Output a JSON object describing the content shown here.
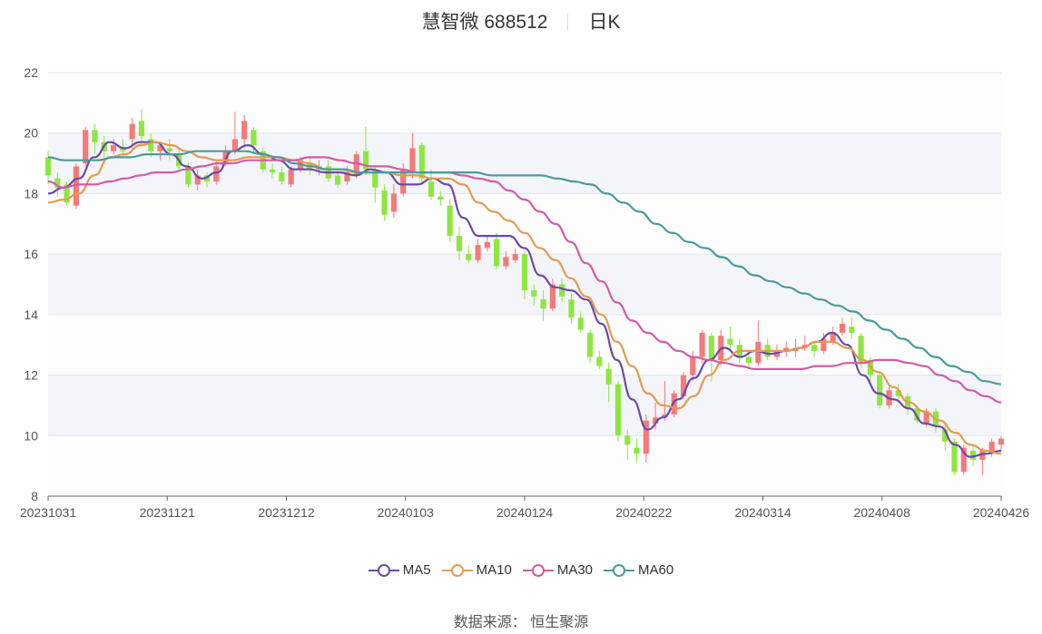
{
  "header": {
    "stock": "慧智微 688512",
    "period": "日K"
  },
  "source": {
    "label": "数据来源：",
    "name": "恒生聚源"
  },
  "colors": {
    "up": "#f47a7a",
    "down": "#8ee640",
    "MA5": "#6a4aa8",
    "MA10": "#e69a50",
    "MA30": "#d45aa7",
    "MA60": "#4b9b9b"
  },
  "chart_data": {
    "type": "candlestick",
    "ylim": [
      8,
      22
    ],
    "yticks": [
      8,
      10,
      12,
      14,
      16,
      18,
      20,
      22
    ],
    "xticks": [
      "20231031",
      "20231121",
      "20231212",
      "20240103",
      "20240124",
      "20240222",
      "20240314",
      "20240408",
      "20240426"
    ],
    "grid": true,
    "legend_position": "bottom",
    "series": [
      {
        "name": "MA5",
        "values": [
          18.0,
          18.2,
          18.5,
          19.2,
          19.7,
          19.5,
          19.7,
          19.7,
          19.3,
          18.9,
          18.5,
          18.7,
          19.4,
          19.6,
          19.3,
          19.1,
          18.8,
          18.8,
          18.7,
          18.7,
          18.6,
          18.8,
          18.7,
          18.3,
          18.3,
          18.5,
          18.3,
          17.2,
          16.6,
          16.6,
          16.6,
          16.2,
          15.3,
          14.9,
          14.8,
          14.5,
          13.7,
          12.5,
          11.2,
          10.2,
          10.6,
          11.2,
          11.9,
          12.5,
          12.9,
          12.6,
          12.8,
          12.7,
          12.8,
          12.9,
          13.1,
          13.4,
          13.0,
          12.0,
          11.4,
          11.2,
          10.9,
          10.4,
          10.3,
          9.7,
          9.3,
          9.4,
          9.5
        ]
      },
      {
        "name": "MA10",
        "values": [
          17.7,
          17.8,
          18.0,
          18.6,
          19.2,
          19.3,
          19.6,
          19.7,
          19.6,
          19.4,
          19.2,
          19.1,
          19.1,
          19.2,
          19.2,
          19.2,
          19.1,
          19.0,
          18.8,
          18.8,
          18.7,
          18.7,
          18.7,
          18.6,
          18.6,
          18.5,
          18.5,
          18.3,
          17.7,
          17.4,
          17.1,
          16.7,
          16.2,
          15.8,
          15.2,
          14.6,
          14.0,
          13.1,
          12.3,
          11.4,
          11.0,
          10.9,
          11.3,
          12.0,
          12.5,
          12.8,
          12.8,
          12.8,
          12.8,
          12.9,
          13.1,
          13.1,
          12.9,
          12.5,
          12.1,
          11.6,
          11.1,
          10.8,
          10.5,
          10.1,
          9.7,
          9.5,
          9.4
        ]
      },
      {
        "name": "MA30",
        "values": [
          18.4,
          18.2,
          18.3,
          18.3,
          18.4,
          18.5,
          18.6,
          18.7,
          18.7,
          18.8,
          18.9,
          19.0,
          19.0,
          19.1,
          19.1,
          19.1,
          19.1,
          19.2,
          19.2,
          19.1,
          19.0,
          18.9,
          18.9,
          18.8,
          18.7,
          18.7,
          18.7,
          18.6,
          18.5,
          18.4,
          18.1,
          17.8,
          17.4,
          17.0,
          16.4,
          15.7,
          15.1,
          14.4,
          13.8,
          13.4,
          13.1,
          12.8,
          12.6,
          12.5,
          12.4,
          12.3,
          12.2,
          12.2,
          12.2,
          12.2,
          12.3,
          12.3,
          12.4,
          12.4,
          12.5,
          12.5,
          12.4,
          12.3,
          12.0,
          11.8,
          11.5,
          11.3,
          11.1
        ]
      },
      {
        "name": "MA60",
        "values": [
          19.2,
          19.1,
          19.1,
          19.1,
          19.2,
          19.2,
          19.3,
          19.3,
          19.3,
          19.4,
          19.4,
          19.4,
          19.4,
          19.3,
          19.2,
          19.0,
          18.9,
          18.8,
          18.8,
          18.7,
          18.7,
          18.7,
          18.7,
          18.7,
          18.7,
          18.7,
          18.7,
          18.6,
          18.6,
          18.6,
          18.6,
          18.5,
          18.4,
          18.3,
          18.0,
          17.7,
          17.4,
          17.0,
          16.7,
          16.4,
          16.2,
          15.9,
          15.6,
          15.3,
          15.1,
          14.9,
          14.7,
          14.5,
          14.3,
          14.1,
          13.8,
          13.5,
          13.2,
          12.9,
          12.6,
          12.3,
          12.1,
          11.8,
          11.7
        ]
      }
    ],
    "candles": {
      "note": "daily OHLC, approximate",
      "ohlc": [
        [
          19.2,
          18.6,
          19.4,
          18.3
        ],
        [
          18.5,
          18.2,
          18.7,
          17.9
        ],
        [
          18.3,
          17.7,
          18.4,
          17.6
        ],
        [
          17.6,
          18.9,
          19.0,
          17.5
        ],
        [
          19.0,
          20.1,
          20.2,
          18.9
        ],
        [
          20.1,
          19.7,
          20.3,
          19.3
        ],
        [
          19.7,
          19.4,
          19.9,
          19.2
        ],
        [
          19.4,
          19.6,
          19.8,
          19.3
        ],
        [
          19.5,
          19.4,
          19.8,
          19.2
        ],
        [
          19.8,
          20.3,
          20.5,
          19.5
        ],
        [
          20.4,
          19.9,
          20.8,
          19.6
        ],
        [
          19.8,
          19.4,
          20.0,
          19.2
        ],
        [
          19.4,
          19.6,
          19.7,
          19.1
        ],
        [
          19.5,
          19.4,
          19.8,
          19.1
        ],
        [
          19.3,
          18.9,
          19.5,
          18.8
        ],
        [
          18.9,
          18.3,
          19.0,
          18.2
        ],
        [
          18.3,
          18.6,
          18.8,
          18.1
        ],
        [
          18.6,
          18.4,
          18.7,
          18.2
        ],
        [
          18.4,
          18.9,
          19.1,
          18.3
        ],
        [
          19.0,
          19.4,
          19.6,
          18.9
        ],
        [
          19.4,
          19.8,
          20.7,
          19.3
        ],
        [
          19.8,
          20.4,
          20.6,
          19.5
        ],
        [
          20.1,
          19.6,
          20.2,
          19.3
        ],
        [
          19.4,
          18.8,
          19.5,
          18.7
        ],
        [
          18.8,
          18.7,
          19.0,
          18.5
        ],
        [
          18.7,
          18.4,
          18.9,
          18.3
        ],
        [
          18.3,
          18.8,
          18.9,
          18.2
        ],
        [
          18.8,
          19.1,
          19.2,
          18.7
        ],
        [
          19.0,
          18.8,
          19.2,
          18.6
        ],
        [
          18.8,
          18.9,
          19.1,
          18.6
        ],
        [
          18.9,
          18.5,
          19.1,
          18.4
        ],
        [
          18.6,
          18.3,
          18.8,
          18.2
        ],
        [
          18.4,
          18.7,
          18.9,
          18.3
        ],
        [
          18.6,
          19.3,
          19.4,
          18.5
        ],
        [
          19.4,
          18.8,
          20.2,
          18.6
        ],
        [
          18.8,
          18.2,
          18.9,
          17.7
        ],
        [
          18.1,
          17.3,
          18.3,
          17.1
        ],
        [
          17.4,
          18.0,
          18.3,
          17.2
        ],
        [
          18.0,
          18.8,
          19.0,
          17.9
        ],
        [
          18.7,
          19.5,
          20.0,
          18.5
        ],
        [
          19.6,
          18.5,
          19.7,
          18.3
        ],
        [
          18.4,
          17.9,
          18.8,
          17.8
        ],
        [
          17.9,
          17.8,
          18.1,
          17.6
        ],
        [
          17.6,
          16.6,
          17.8,
          16.4
        ],
        [
          16.6,
          16.1,
          16.9,
          15.8
        ],
        [
          16.0,
          15.8,
          16.3,
          15.7
        ],
        [
          15.8,
          16.3,
          16.5,
          15.7
        ],
        [
          16.2,
          16.4,
          16.6,
          16.1
        ],
        [
          16.5,
          15.6,
          16.7,
          15.5
        ],
        [
          15.6,
          15.9,
          16.1,
          15.5
        ],
        [
          15.8,
          16.0,
          16.2,
          15.7
        ],
        [
          16.0,
          14.8,
          16.1,
          14.5
        ],
        [
          14.8,
          14.6,
          15.0,
          14.3
        ],
        [
          14.5,
          14.2,
          14.8,
          13.8
        ],
        [
          14.2,
          15.0,
          15.2,
          14.1
        ],
        [
          15.0,
          14.6,
          15.2,
          14.4
        ],
        [
          14.5,
          13.9,
          14.7,
          13.7
        ],
        [
          13.9,
          13.5,
          14.1,
          13.4
        ],
        [
          13.4,
          12.6,
          13.5,
          12.4
        ],
        [
          12.6,
          12.3,
          12.8,
          12.2
        ],
        [
          12.2,
          11.7,
          12.4,
          11.1
        ],
        [
          11.7,
          10.0,
          11.8,
          9.8
        ],
        [
          10.0,
          9.7,
          10.2,
          9.2
        ],
        [
          9.6,
          9.4,
          9.9,
          9.1
        ],
        [
          9.4,
          10.5,
          10.7,
          9.1
        ],
        [
          10.4,
          10.6,
          11.1,
          10.2
        ],
        [
          10.6,
          10.7,
          11.8,
          10.5
        ],
        [
          10.7,
          11.4,
          11.5,
          10.6
        ],
        [
          11.3,
          12.0,
          12.1,
          11.2
        ],
        [
          12.0,
          12.6,
          12.8,
          11.8
        ],
        [
          12.6,
          13.4,
          13.5,
          12.4
        ],
        [
          13.3,
          12.5,
          13.4,
          11.8
        ],
        [
          12.5,
          13.3,
          13.5,
          12.3
        ],
        [
          13.2,
          13.0,
          13.6,
          12.8
        ],
        [
          13.0,
          12.6,
          13.2,
          12.4
        ],
        [
          12.6,
          12.4,
          12.8,
          12.2
        ],
        [
          12.4,
          13.1,
          13.8,
          12.3
        ],
        [
          13.0,
          12.6,
          13.2,
          12.5
        ],
        [
          12.6,
          12.8,
          13.0,
          12.5
        ],
        [
          12.8,
          12.9,
          13.1,
          12.6
        ],
        [
          12.8,
          12.9,
          13.2,
          12.6
        ],
        [
          12.9,
          13.0,
          13.3,
          12.8
        ],
        [
          13.0,
          12.8,
          13.1,
          12.6
        ],
        [
          12.8,
          13.2,
          13.4,
          12.7
        ],
        [
          13.1,
          13.4,
          13.6,
          13.0
        ],
        [
          13.4,
          13.7,
          13.9,
          13.3
        ],
        [
          13.6,
          13.4,
          13.9,
          13.2
        ],
        [
          13.3,
          12.4,
          13.4,
          12.2
        ],
        [
          12.5,
          12.0,
          12.6,
          11.8
        ],
        [
          12.0,
          11.0,
          12.1,
          10.9
        ],
        [
          11.0,
          11.5,
          11.6,
          10.9
        ],
        [
          11.5,
          11.3,
          11.7,
          11.1
        ],
        [
          11.3,
          10.9,
          11.4,
          10.7
        ],
        [
          10.9,
          10.5,
          11.0,
          10.4
        ],
        [
          10.4,
          10.8,
          10.9,
          10.3
        ],
        [
          10.8,
          10.3,
          10.9,
          10.1
        ],
        [
          10.2,
          9.8,
          10.4,
          9.5
        ],
        [
          9.8,
          8.8,
          9.9,
          8.7
        ],
        [
          8.8,
          9.6,
          9.7,
          8.7
        ],
        [
          9.5,
          9.2,
          9.7,
          9.0
        ],
        [
          9.2,
          9.5,
          9.6,
          8.7
        ],
        [
          9.4,
          9.8,
          9.9,
          9.3
        ],
        [
          9.7,
          9.9,
          10.0,
          9.5
        ]
      ]
    }
  }
}
